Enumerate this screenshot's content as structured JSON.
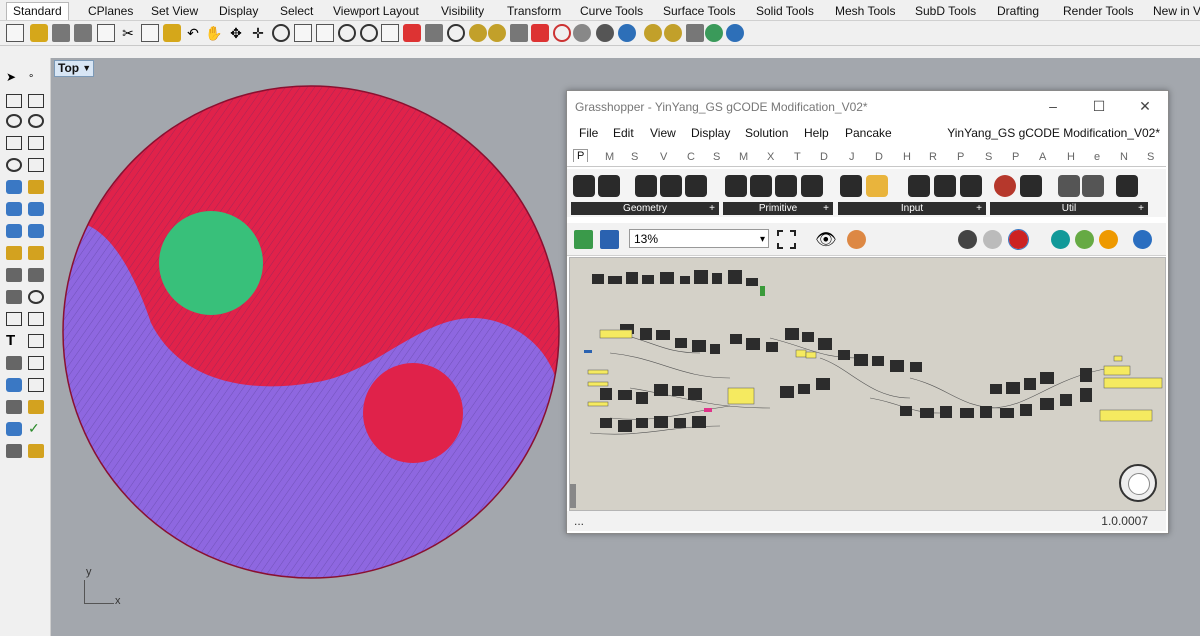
{
  "rhino": {
    "tabs": [
      "Standard",
      "CPlanes",
      "Set View",
      "Display",
      "Select",
      "Viewport Layout",
      "Visibility",
      "Transform",
      "Curve Tools",
      "Surface Tools",
      "Solid Tools",
      "Mesh Tools",
      "SubD Tools",
      "Drafting",
      "Render Tools",
      "New in V"
    ],
    "active_tab": "Standard",
    "viewport_label": "Top",
    "axis_x": "x",
    "axis_y": "y",
    "colors": {
      "yang": "#e0224a",
      "yin": "#8e67e0",
      "eye_in_yang": "#38c07a",
      "eye_in_yin": "#e0224a",
      "viewport_bg": "#a3a7ad"
    }
  },
  "grasshopper": {
    "window_title": "Grasshopper - YinYang_GS gCODE Modification_V02*",
    "doc_title": "YinYang_GS gCODE Modification_V02*",
    "menu": [
      "File",
      "Edit",
      "View",
      "Display",
      "Solution",
      "Help",
      "Pancake"
    ],
    "tabs": [
      "P",
      "M",
      "S",
      "V",
      "C",
      "S",
      "M",
      "X",
      "T",
      "D",
      "J",
      "D",
      "H",
      "R",
      "P",
      "S",
      "P",
      "A",
      "H",
      "e",
      "N",
      "S"
    ],
    "active_tab": "P",
    "ribbon_groups": [
      "Geometry",
      "Primitive",
      "Input",
      "Util"
    ],
    "zoom": "13%",
    "status_left": "...",
    "version": "1.0.0007"
  }
}
